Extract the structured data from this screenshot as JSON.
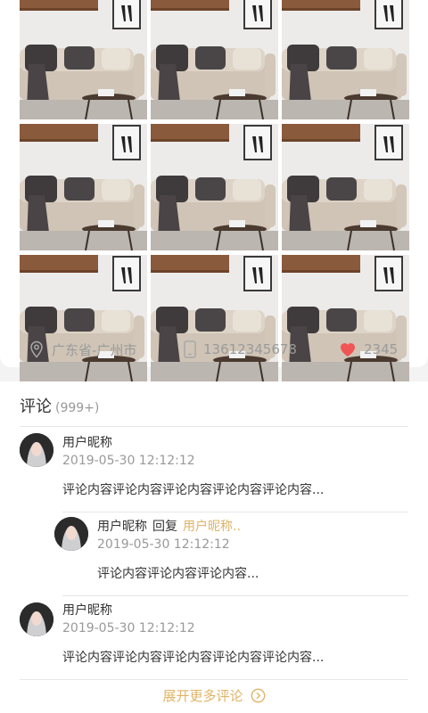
{
  "photos": {
    "count": 9,
    "alt": "sofa-living-room-photo"
  },
  "info": {
    "location": "广东省-广州市",
    "phone": "13612345678",
    "likes": "2345"
  },
  "comments": {
    "title": "评论",
    "count": "(999+)",
    "items": [
      {
        "user": "用户昵称",
        "time": "2019-05-30 12:12:12",
        "text": "评论内容评论内容评论内容评论内容评论内容..."
      },
      {
        "user": "用户昵称",
        "reply_word": "回复",
        "reply_target": "用户昵称..",
        "time": "2019-05-30 12:12:12",
        "text": "评论内容评论内容评论内容..."
      },
      {
        "user": "用户昵称",
        "time": "2019-05-30 12:12:12",
        "text": "评论内容评论内容评论内容评论内容评论内容..."
      }
    ],
    "more_label": "展开更多评论"
  },
  "colors": {
    "accent": "#e0b366",
    "heart": "#f05454"
  }
}
